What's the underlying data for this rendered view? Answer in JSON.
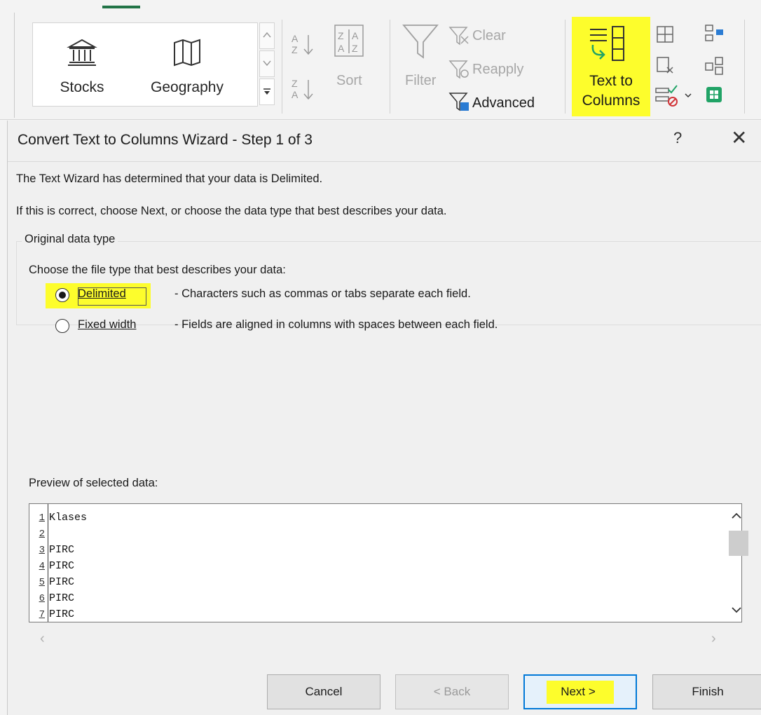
{
  "ribbon": {
    "gallery": [
      {
        "label": "Stocks",
        "icon": "bank-icon"
      },
      {
        "label": "Geography",
        "icon": "map-icon"
      }
    ],
    "sort_label": "Sort",
    "filter_label": "Filter",
    "clear_label": "Clear",
    "reapply_label": "Reapply",
    "advanced_label": "Advanced",
    "text_to_columns_line1": "Text to",
    "text_to_columns_line2": "Columns",
    "highlight_color": "#fdfd2c"
  },
  "dialog": {
    "title": "Convert Text to Columns Wizard - Step 1 of 3",
    "help": "?",
    "close": "✕",
    "message1": "The Text Wizard has determined that your data is Delimited.",
    "message2": "If this is correct, choose Next, or choose the data type that best describes your data.",
    "group_label": "Original data type",
    "choose_prompt": "Choose the file type that best describes your data:",
    "options": [
      {
        "label": "Delimited",
        "description": "- Characters such as commas or tabs separate each field.",
        "selected": true
      },
      {
        "label": "Fixed width",
        "description": "- Fields are aligned in columns with spaces between each field.",
        "selected": false
      }
    ],
    "preview_label": "Preview of selected data:",
    "preview_rows": [
      {
        "num": "1",
        "value": "Klases"
      },
      {
        "num": "2",
        "value": ""
      },
      {
        "num": "3",
        "value": "PIRC"
      },
      {
        "num": "4",
        "value": "PIRC"
      },
      {
        "num": "5",
        "value": "PIRC"
      },
      {
        "num": "6",
        "value": "PIRC"
      },
      {
        "num": "7",
        "value": "PIRC"
      }
    ],
    "buttons": {
      "cancel": "Cancel",
      "back": "< Back",
      "next": "Next >",
      "finish": "Finish"
    }
  }
}
